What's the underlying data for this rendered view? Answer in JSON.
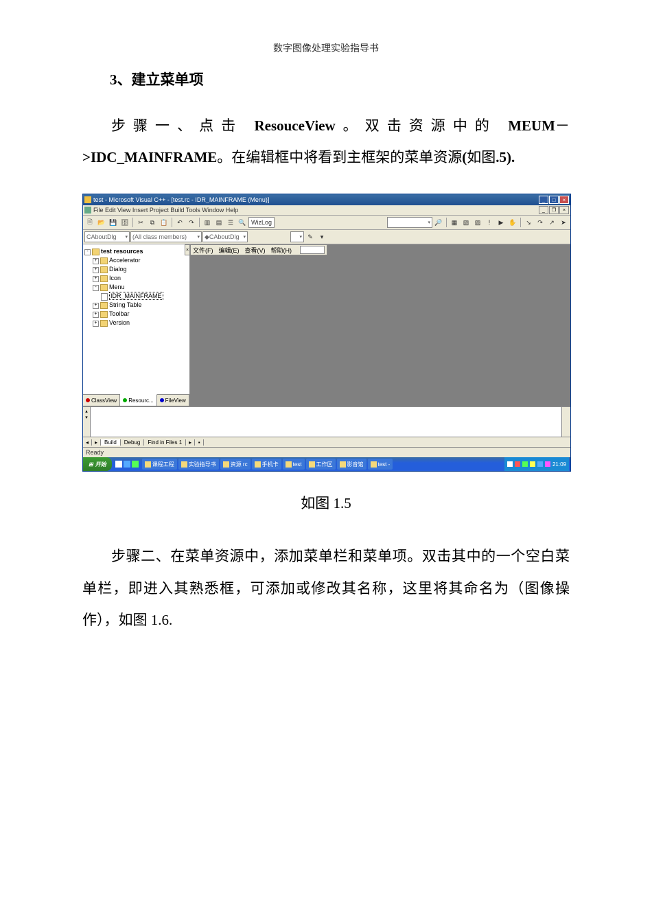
{
  "doc": {
    "header": "数字图像处理实验指导书",
    "section_no": "3",
    "section_title": "、建立菜单项",
    "para1_a": "步骤一、点击 ",
    "para1_b": "ResouceView",
    "para1_c": "。双击资源中的 ",
    "para1_d": "MEUM",
    "para1_e": "－",
    "para1_f": ">IDC_MAINFRAME",
    "para1_g": "。在编辑框中将看到主框架的菜单资源",
    "para1_h": "(",
    "para1_i": "如图",
    "para1_j": ".5).",
    "caption": "如图 1.5",
    "para2": "步骤二、在菜单资源中，添加菜单栏和菜单项。双击其中的一个空白菜单栏，即进入其熟悉框，可添加或修改其名称，这里将其命名为（图像操作），如图 1.6."
  },
  "ide": {
    "title": "test - Microsoft Visual C++ - [test.rc - IDR_MAINFRAME (Menu)]",
    "menubar": "File  Edit  View  Insert  Project  Build  Tools  Window  Help",
    "combo_class": "CAboutDlg",
    "combo_members": "(All class members)",
    "combo_func": "CAboutDlg",
    "wizbar_label": "WizLog",
    "tree": {
      "root": "test resources",
      "items": [
        "Accelerator",
        "Dialog",
        "Icon",
        "Menu",
        "String Table",
        "Toolbar",
        "Version"
      ],
      "menu_child": "IDR_MAINFRAME"
    },
    "ws_tabs": [
      "ClassView",
      "Resourc...",
      "FileView"
    ],
    "menu_editor_items": [
      "文件(F)",
      "编辑(E)",
      "查看(V)",
      "帮助(H)"
    ],
    "output_tabs": {
      "build": "Build",
      "debug": "Debug",
      "find": "Find in Files 1"
    },
    "status": "Ready"
  },
  "taskbar": {
    "start": "开始",
    "items": [
      "",
      "课程工程",
      "实验指导书",
      "资源 rc",
      "手机卡",
      "test",
      "工作区",
      "影音馆",
      "test -"
    ],
    "time": "21:09"
  }
}
